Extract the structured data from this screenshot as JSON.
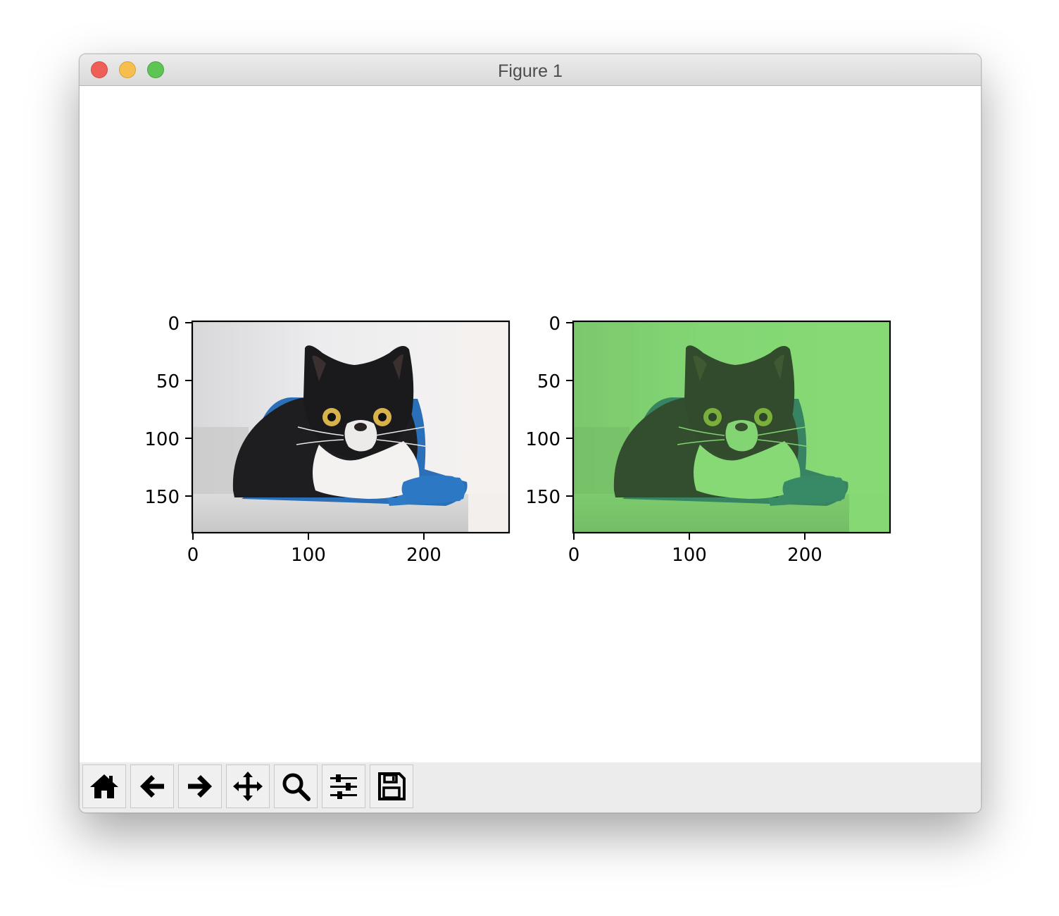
{
  "window": {
    "title": "Figure 1"
  },
  "toolbar": {
    "buttons": [
      {
        "name": "home-button",
        "icon": "home-icon"
      },
      {
        "name": "back-button",
        "icon": "arrow-left-icon"
      },
      {
        "name": "forward-button",
        "icon": "arrow-right-icon"
      },
      {
        "name": "pan-button",
        "icon": "move-icon"
      },
      {
        "name": "zoom-button",
        "icon": "magnifier-icon"
      },
      {
        "name": "configure-subplots-button",
        "icon": "sliders-icon"
      },
      {
        "name": "save-button",
        "icon": "floppy-disk-icon"
      }
    ]
  },
  "axes": [
    {
      "image": "photo of a black and white cat on a blue mat",
      "xticks": [
        "0",
        "100",
        "200"
      ],
      "yticks": [
        "0",
        "50",
        "100",
        "150"
      ],
      "tint": "none"
    },
    {
      "image": "same cat photo with green tint",
      "xticks": [
        "0",
        "100",
        "200"
      ],
      "yticks": [
        "0",
        "50",
        "100",
        "150"
      ],
      "tint": "#8fe07f"
    }
  ]
}
